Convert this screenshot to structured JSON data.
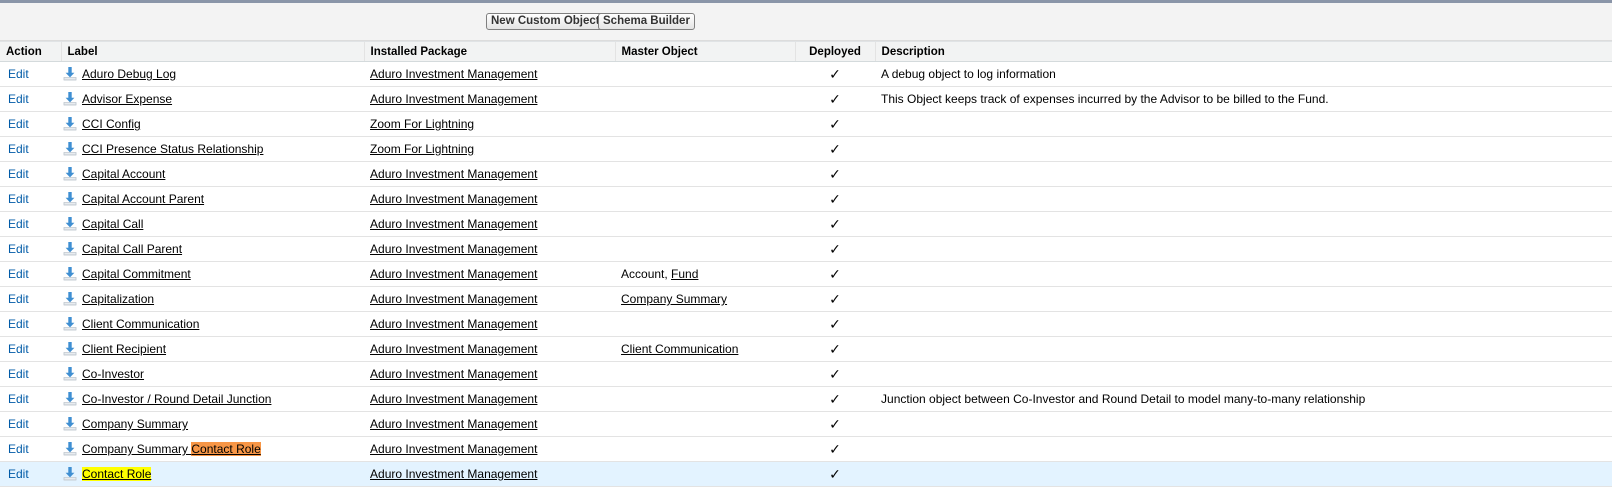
{
  "toolbar": {
    "new_custom_object": "New Custom Object",
    "schema_builder": "Schema Builder"
  },
  "columns": {
    "action": "Action",
    "label": "Label",
    "installed_package": "Installed Package",
    "master_object": "Master Object",
    "deployed": "Deployed",
    "description": "Description"
  },
  "action_label": "Edit",
  "deployed_mark": "✓",
  "highlight_colors": {
    "partial_match": "#f79646",
    "exact_match": "#ffff00",
    "selected_row": "#e3f3ff"
  },
  "rows": [
    {
      "label": "Aduro Debug Log",
      "package": "Aduro Investment Management",
      "master": [],
      "deployed": true,
      "description": "A debug object to log information"
    },
    {
      "label": "Advisor Expense",
      "package": "Aduro Investment Management",
      "master": [],
      "deployed": true,
      "description": "This Object keeps track of expenses incurred by the Advisor to be billed to the Fund."
    },
    {
      "label": "CCI Config",
      "package": "Zoom For Lightning",
      "master": [],
      "deployed": true,
      "description": ""
    },
    {
      "label": "CCI Presence Status Relationship",
      "package": "Zoom For Lightning",
      "master": [],
      "deployed": true,
      "description": ""
    },
    {
      "label": "Capital Account",
      "package": "Aduro Investment Management",
      "master": [],
      "deployed": true,
      "description": ""
    },
    {
      "label": "Capital Account Parent",
      "package": "Aduro Investment Management",
      "master": [],
      "deployed": true,
      "description": ""
    },
    {
      "label": "Capital Call",
      "package": "Aduro Investment Management",
      "master": [],
      "deployed": true,
      "description": ""
    },
    {
      "label": "Capital Call Parent",
      "package": "Aduro Investment Management",
      "master": [],
      "deployed": true,
      "description": ""
    },
    {
      "label": "Capital Commitment",
      "package": "Aduro Investment Management",
      "master": [
        {
          "text": "Account, ",
          "link": false
        },
        {
          "text": "Fund",
          "link": true
        }
      ],
      "deployed": true,
      "description": ""
    },
    {
      "label": "Capitalization",
      "package": "Aduro Investment Management",
      "master": [
        {
          "text": "Company Summary",
          "link": true
        }
      ],
      "deployed": true,
      "description": ""
    },
    {
      "label": "Client Communication",
      "package": "Aduro Investment Management",
      "master": [],
      "deployed": true,
      "description": ""
    },
    {
      "label": "Client Recipient",
      "package": "Aduro Investment Management",
      "master": [
        {
          "text": "Client Communication",
          "link": true
        }
      ],
      "deployed": true,
      "description": ""
    },
    {
      "label": "Co-Investor",
      "package": "Aduro Investment Management",
      "master": [],
      "deployed": true,
      "description": ""
    },
    {
      "label": "Co-Investor / Round Detail Junction",
      "package": "Aduro Investment Management",
      "master": [],
      "deployed": true,
      "description": "Junction object between Co-Investor and Round Detail to model many-to-many relationship"
    },
    {
      "label": "Company Summary",
      "package": "Aduro Investment Management",
      "master": [],
      "deployed": true,
      "description": ""
    },
    {
      "label": "Company Summary ",
      "label_highlight": "Contact Role",
      "highlight_style": "partial",
      "package": "Aduro Investment Management",
      "master": [],
      "deployed": true,
      "description": ""
    },
    {
      "label": "",
      "label_highlight": "Contact Role",
      "highlight_style": "exact",
      "selected": true,
      "package": "Aduro Investment Management",
      "master": [],
      "deployed": true,
      "description": ""
    }
  ]
}
